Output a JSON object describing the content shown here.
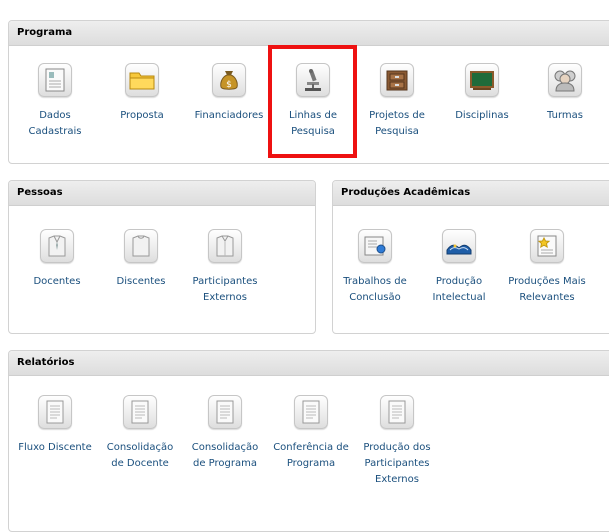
{
  "programa": {
    "title": "Programa",
    "items": [
      {
        "label": "Dados\nCadastrais",
        "icon": "document-icon"
      },
      {
        "label": "Proposta",
        "icon": "folder-icon"
      },
      {
        "label": "Financiadores",
        "icon": "money-bag-icon"
      },
      {
        "label": "Linhas de\nPesquisa",
        "icon": "microscope-icon"
      },
      {
        "label": "Projetos de\nPesquisa",
        "icon": "file-cabinet-icon"
      },
      {
        "label": "Disciplinas",
        "icon": "chalkboard-icon"
      },
      {
        "label": "Turmas",
        "icon": "group-icon"
      }
    ]
  },
  "pessoas": {
    "title": "Pessoas",
    "items": [
      {
        "label": "Docentes",
        "icon": "teacher-icon"
      },
      {
        "label": "Discentes",
        "icon": "student-icon"
      },
      {
        "label": "Participantes\nExternos",
        "icon": "participant-icon"
      }
    ]
  },
  "producoes": {
    "title": "Produções Acadêmicas",
    "items": [
      {
        "label": "Trabalhos de\nConclusão",
        "icon": "certificate-icon"
      },
      {
        "label": "Produção\nIntelectual",
        "icon": "open-book-icon"
      },
      {
        "label": "Produções Mais\nRelevantes",
        "icon": "star-document-icon"
      }
    ]
  },
  "relatorios": {
    "title": "Relatórios",
    "items": [
      {
        "label": "Fluxo Discente",
        "icon": "report-icon"
      },
      {
        "label": "Consolidação\nde Docente",
        "icon": "report-icon"
      },
      {
        "label": "Consolidação\nde Programa",
        "icon": "report-icon"
      },
      {
        "label": "Conferência de\nPrograma",
        "icon": "report-icon"
      },
      {
        "label": "Produção dos\nParticipantes\nExternos",
        "icon": "report-icon"
      }
    ]
  },
  "colors": {
    "link": "#1a4f7d",
    "highlight": "#ee1111",
    "header_bg": "#e4e4e4"
  }
}
